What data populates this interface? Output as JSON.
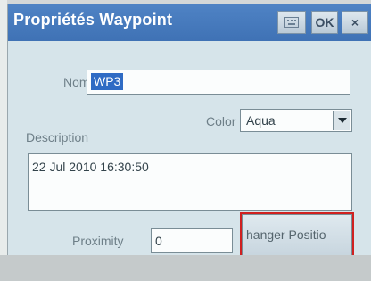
{
  "window": {
    "title": "Propriétés Waypoint",
    "keyboard_icon": "keyboard-icon",
    "ok_label": "OK",
    "close_label": "×"
  },
  "form": {
    "name_label": "Nom",
    "name_value": "WP3",
    "color_label": "Color",
    "color_value": "Aqua",
    "description_label": "Description",
    "description_value": "22 Jul 2010 16:30:50",
    "proximity_label": "Proximity",
    "proximity_value": "0",
    "change_position_label": "hanger Positio"
  },
  "colors": {
    "titlebar": "#4576bb",
    "dialog_bg": "#d6e4ea",
    "highlight_outline": "#d02020",
    "selection": "#2f6bc4"
  }
}
